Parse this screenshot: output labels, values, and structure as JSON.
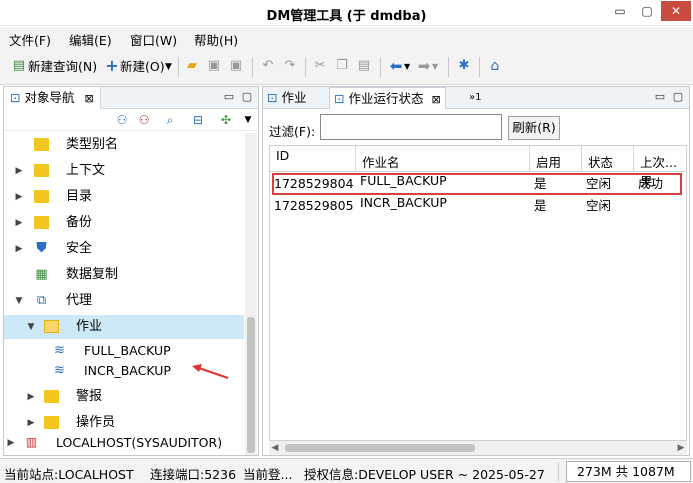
{
  "window": {
    "title": "DM管理工具 (于 dmdba)",
    "min": "▭",
    "max": "▢",
    "close": "✕"
  },
  "menu": [
    "文件(F)",
    "编辑(E)",
    "窗口(W)",
    "帮助(H)"
  ],
  "toolbar": {
    "new_query": "新建查询(N)",
    "new": "新建(O)"
  },
  "nav_panel": {
    "tab_label": "对象导航",
    "tab_close": "⊠",
    "min": "▭",
    "max": "▢",
    "tree": [
      {
        "label": "类型别名",
        "expanded": null,
        "icon": "folder-icon"
      },
      {
        "label": "上下文",
        "expanded": false,
        "icon": "folder-icon"
      },
      {
        "label": "目录",
        "expanded": false,
        "icon": "folder-icon"
      },
      {
        "label": "备份",
        "expanded": false,
        "icon": "folder-icon"
      },
      {
        "label": "安全",
        "expanded": false,
        "icon": "shield-icon"
      },
      {
        "label": "数据复制",
        "expanded": null,
        "icon": "replication-icon"
      },
      {
        "label": "代理",
        "expanded": true,
        "icon": "agent-icon"
      },
      {
        "label": "作业",
        "expanded": true,
        "icon": "folder-open-icon",
        "selected": true
      },
      {
        "label": "FULL_BACKUP",
        "expanded": null,
        "icon": "job-icon"
      },
      {
        "label": "INCR_BACKUP",
        "expanded": null,
        "icon": "job-icon"
      },
      {
        "label": "警报",
        "expanded": false,
        "icon": "folder-icon"
      },
      {
        "label": "操作员",
        "expanded": false,
        "icon": "folder-icon"
      },
      {
        "label": "LOCALHOST(SYSAUDITOR)",
        "expanded": false,
        "icon": "server-icon"
      }
    ]
  },
  "right_panel": {
    "tabs": [
      {
        "label": "作业",
        "active": false
      },
      {
        "label": "作业运行状态",
        "active": true,
        "close": "⊠"
      }
    ],
    "overflow": "»1",
    "min": "▭",
    "max": "▢",
    "filter_label": "过滤(F):",
    "filter_value": "",
    "refresh_label": "刷新(R)",
    "columns": [
      "ID",
      "作业名",
      "启用",
      "状态",
      "上次...果"
    ],
    "rows": [
      {
        "id": "1728529804",
        "name": "FULL_BACKUP",
        "enabled": "是",
        "status": "空闲",
        "last": "成功"
      },
      {
        "id": "1728529805",
        "name": "INCR_BACKUP",
        "enabled": "是",
        "status": "空闲",
        "last": ""
      }
    ]
  },
  "statusbar": {
    "site": "当前站点:LOCALHOST",
    "port": "连接端口:5236",
    "login": "当前登...",
    "license": "授权信息:DEVELOP USER ~ 2025-05-27",
    "memory": "273M 共 1087M"
  },
  "colors": {
    "selection": "#cde8f7",
    "highlight_border": "#d94040",
    "folder": "#f3c51f",
    "accent_blue": "#2a6fc4"
  }
}
